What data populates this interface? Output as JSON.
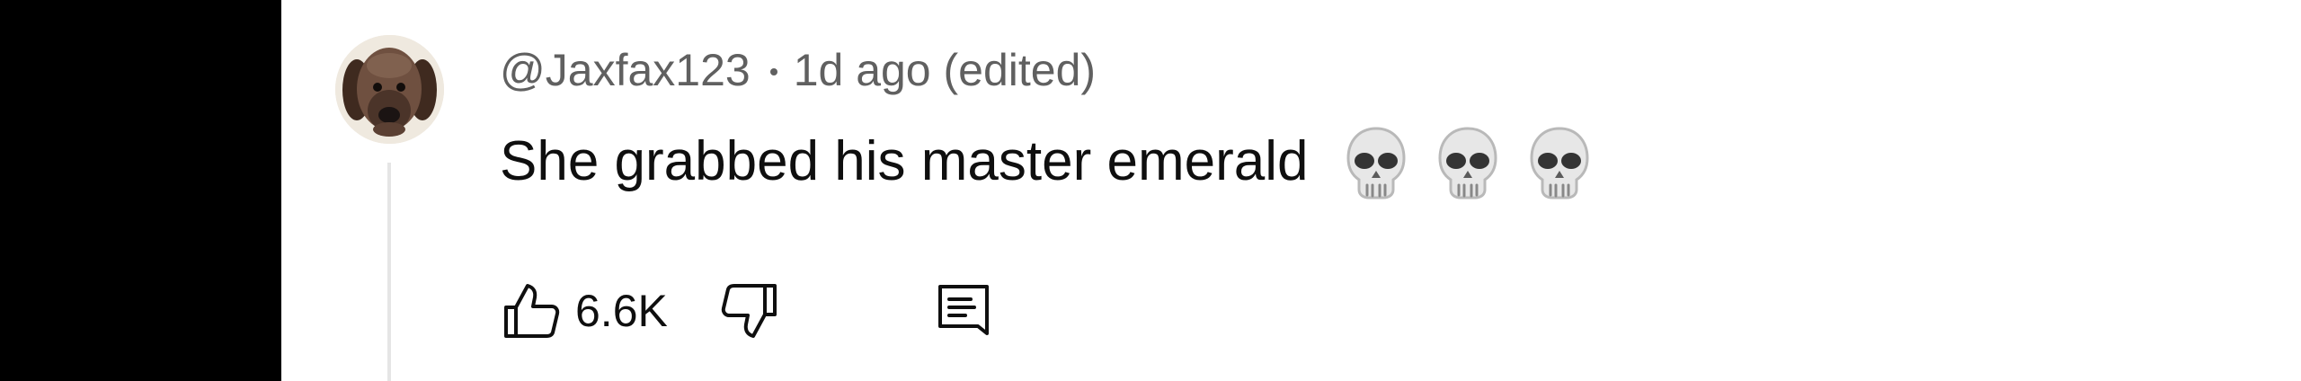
{
  "comment": {
    "author": "@Jaxfax123",
    "separator": "•",
    "timestamp": "1d ago (edited)",
    "text": "She grabbed his master emerald",
    "emoji": [
      "skull-emoji",
      "skull-emoji",
      "skull-emoji"
    ],
    "like_count": "6.6K"
  },
  "icons": {
    "avatar": "dog-avatar",
    "like": "thumbs-up-icon",
    "dislike": "thumbs-down-icon",
    "reply": "comment-reply-icon"
  },
  "colors": {
    "left_bar": "#000000",
    "secondary_text": "#606060",
    "primary_text": "#0f0f0f",
    "thread_line": "#e5e5e5"
  }
}
